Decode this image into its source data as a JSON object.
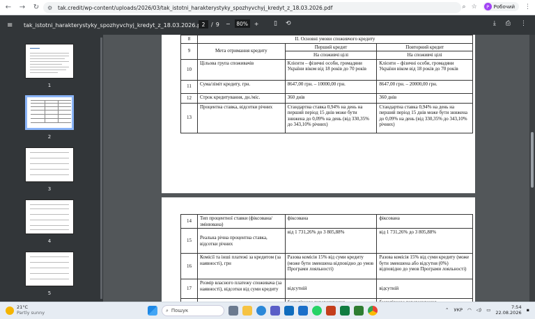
{
  "browser": {
    "url": "tak.credit/wp-content/uploads/2026/03/tak_istotni_harakterystyky_spozhyvchyj_kredyt_z_18.03.2026.pdf",
    "profile_label": "Робочий",
    "profile_initial": "Р"
  },
  "pdf_toolbar": {
    "file_title": "tak_istotni_harakterystyky_spozhyvchyj_kredyt_z_18.03.2026.pdf",
    "current_page": "2",
    "page_sep": "/",
    "total_pages": "9",
    "zoom": "80%",
    "zoom_out": "−",
    "zoom_in": "+"
  },
  "thumbnails": [
    "1",
    "2",
    "3",
    "4",
    "5"
  ],
  "table_top": {
    "row8": {
      "num": "8",
      "text": "ІІ. Основні умови споживчого кредиту"
    },
    "row9": {
      "num": "9",
      "label": "Мета отримання кредиту",
      "h1": "Перший кредит",
      "h2": "Повторний кредит",
      "v1": "На споживчі цілі",
      "v2": "На споживчі цілі"
    },
    "row10": {
      "num": "10",
      "label": "Цільова група споживачів",
      "v1": "Клієнти – фізичні особи, громадяни України віком від 18 років до 70 років",
      "v2": "Клієнти – фізичні особи, громадяни України віком від 18 років до 70 років"
    },
    "row11": {
      "num": "11",
      "label": "Сума/ліміт кредиту, грн.",
      "v1": "8647,00 грн. – 10000,00 грн.",
      "v2": "8647,00 грн. – 20000,00 грн."
    },
    "row12": {
      "num": "12",
      "label": "Строк кредитування, дн./міс.",
      "v1": "360 днів",
      "v2": "360 днів"
    },
    "row13": {
      "num": "13",
      "label": "Процентна ставка, відсотки річних",
      "v1": "Стандартна ставка 0,94% на день на перший період 15 днів може бути знижена до 0,09% на день (від 330,35% до 343,10% річних)",
      "v2": "Стандартна ставка 0,94% на день на перший період 15 днів може бути знижена до 0,09% на день (від 330,35% до 343,10% річних)"
    }
  },
  "table_bottom": {
    "row14": {
      "num": "14",
      "label": "Тип процентної ставки (фіксована/змінювана)",
      "v1": "фіксована",
      "v2": "фіксована"
    },
    "row15": {
      "num": "15",
      "label": "Реальна річна процентна ставка, відсотки річних",
      "v1": "від 1 731,26% до 3 805,88%",
      "v2": "від 1 731,26% до 3 805,88%"
    },
    "row16": {
      "num": "16",
      "label": "Комісії та інші платежі за кредитом (за наявності), грн",
      "v1": "Разова комісія 15% від суми кредиту (може бути зменшена відповідно до умов Програми лояльності)",
      "v2": "Разова комісія 15% від суми кредиту (може бути зменшена або відсутня (0%) відповідно до умов Програми лояльності)"
    },
    "row17": {
      "num": "17",
      "label": "Розмір власного платежу споживача (за наявності), відсотки від суми кредиту",
      "v1": "відсутній",
      "v2": "відсутній"
    },
    "row18": {
      "v1": "безготівкове перерахування",
      "v2": "безготівкове перерахування"
    }
  },
  "taskbar": {
    "temp": "21°C",
    "weather": "Partly sunny",
    "search": "Пошук",
    "lang": "УКР",
    "time": "7:54",
    "date": "22.08.2026"
  },
  "colors": {
    "pdf_toolbar": "#323639",
    "viewer_bg": "#525659",
    "thumb_active": "#8ab4f8"
  }
}
